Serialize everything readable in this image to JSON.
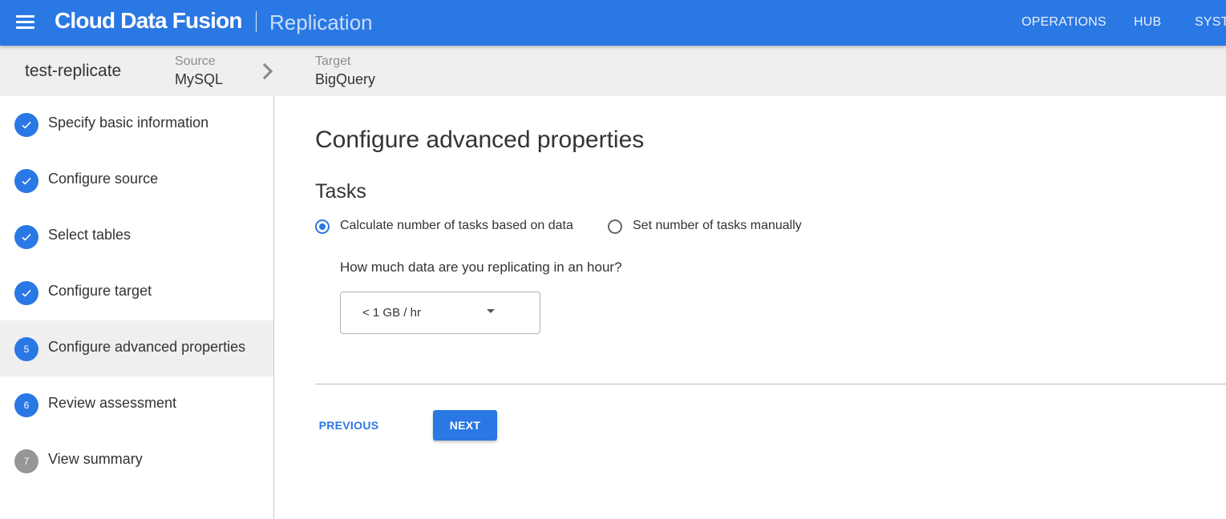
{
  "colors": {
    "brand": "#2a78e4",
    "step_pending": "#969696"
  },
  "appbar": {
    "brand": "Cloud Data Fusion",
    "product": "Replication",
    "nav": [
      "OPERATIONS",
      "HUB",
      "SYSTEM"
    ]
  },
  "header": {
    "pipeline_name": "test-replicate",
    "source_label": "Source",
    "source_value": "MySQL",
    "target_label": "Target",
    "target_value": "BigQuery"
  },
  "steps": [
    {
      "badge": "",
      "label": "Specify basic information",
      "state": "done",
      "icon": "check-icon"
    },
    {
      "badge": "",
      "label": "Configure source",
      "state": "done",
      "icon": "check-icon"
    },
    {
      "badge": "",
      "label": "Select tables",
      "state": "done",
      "icon": "check-icon"
    },
    {
      "badge": "",
      "label": "Configure target",
      "state": "done",
      "icon": "check-icon"
    },
    {
      "badge": "5",
      "label": "Configure advanced properties",
      "state": "active"
    },
    {
      "badge": "6",
      "label": "Review assessment",
      "state": "pending"
    },
    {
      "badge": "7",
      "label": "View summary",
      "state": "pending"
    }
  ],
  "main": {
    "title": "Configure advanced properties",
    "section": "Tasks",
    "radios": [
      {
        "label": "Calculate number of tasks based on data",
        "checked": true
      },
      {
        "label": "Set number of tasks manually",
        "checked": false
      }
    ],
    "question": "How much data are you replicating in an hour?",
    "data_rate_selected": "< 1 GB / hr",
    "prev_label": "PREVIOUS",
    "next_label": "NEXT"
  }
}
